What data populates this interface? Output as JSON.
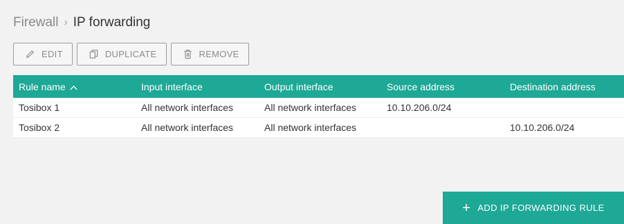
{
  "breadcrumb": {
    "parent": "Firewall",
    "separator": "›",
    "current": "IP forwarding"
  },
  "toolbar": {
    "edit_label": "EDIT",
    "duplicate_label": "DUPLICATE",
    "remove_label": "REMOVE"
  },
  "table": {
    "columns": [
      "Rule name",
      "Input interface",
      "Output interface",
      "Source address",
      "Destination address"
    ],
    "sort": {
      "column": "Rule name",
      "direction": "ascending"
    },
    "rows": [
      [
        "Tosibox 1",
        "All network interfaces",
        "All network interfaces",
        "10.10.206.0/24",
        ""
      ],
      [
        "Tosibox 2",
        "All network interfaces",
        "All network interfaces",
        "",
        "10.10.206.0/24"
      ]
    ]
  },
  "add_button": {
    "label": "ADD IP FORWARDING RULE",
    "icon": "plus-icon"
  },
  "colors": {
    "accent": "#1ea896",
    "background": "#f2f2f2"
  }
}
